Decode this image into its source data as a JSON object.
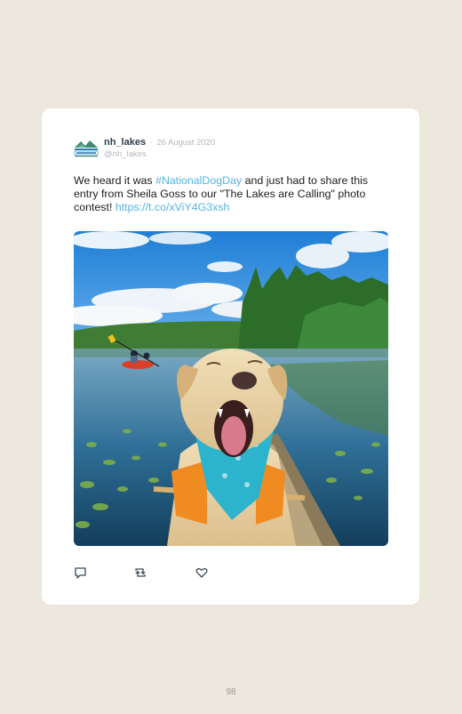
{
  "tweet": {
    "display_name": "nh_lakes",
    "separator": "·",
    "date": "26 August 2020",
    "handle": "@nh_lakes",
    "avatar_icon": "nh-lakes-logo-icon",
    "text_part1": "We heard it was ",
    "hashtag": "#NationalDogDay",
    "text_part2": " and just had to share this entry from Sheila Goss to our \"The Lakes are Calling\" photo contest! ",
    "link": "https://t.co/xViY4G3xsh",
    "photo_icon": "yawning-dog-in-canoe-photo",
    "link_color": "#55b4e4"
  },
  "actions": {
    "reply_icon": "reply-icon",
    "retweet_icon": "retweet-icon",
    "like_icon": "heart-icon"
  },
  "footer": {
    "page_number": "98"
  }
}
